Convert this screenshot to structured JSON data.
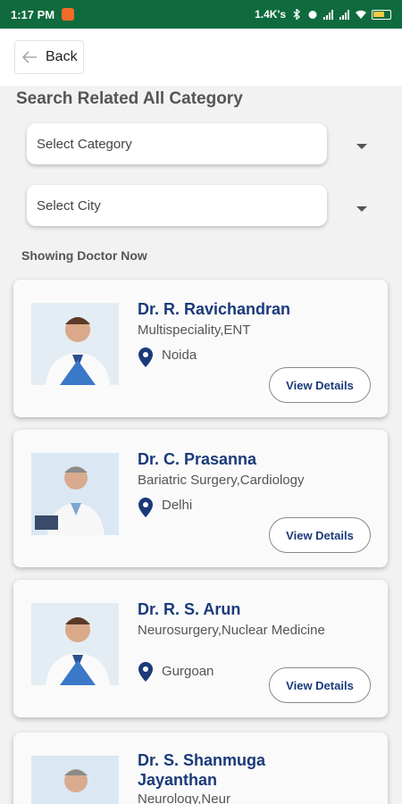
{
  "status_bar": {
    "time": "1:17 PM",
    "speed": "1.4K's",
    "icons": [
      "bluetooth-icon",
      "alarm-icon",
      "signal-icon",
      "signal-icon",
      "wifi-icon",
      "battery-icon"
    ]
  },
  "header": {
    "back_label": "Back"
  },
  "search": {
    "title": "Search Related All Category",
    "category_placeholder": "Select Category",
    "city_placeholder": "Select City"
  },
  "list": {
    "heading": "Showing Doctor Now",
    "view_label": "View Details",
    "doctors": [
      {
        "name": "Dr. R. Ravichandran",
        "specialty": "Multispeciality,ENT",
        "city": "Noida"
      },
      {
        "name": "Dr. C. Prasanna",
        "specialty": "Bariatric Surgery,Cardiology",
        "city": "Delhi"
      },
      {
        "name": "Dr. R. S. Arun",
        "specialty": "Neurosurgery,Nuclear Medicine",
        "city": "Gurgoan"
      },
      {
        "name": "Dr. S. Shanmuga Jayanthan",
        "specialty": "Neurology,Neur",
        "city": ""
      }
    ]
  },
  "colors": {
    "status_bar": "#0f6b3e",
    "accent": "#1a3a7a"
  }
}
